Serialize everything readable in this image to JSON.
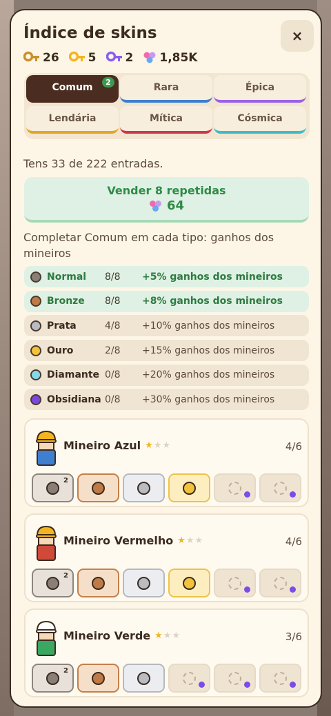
{
  "title": "Índice de skins",
  "close_label": "×",
  "currencies": [
    {
      "icon": "bronze-key-icon",
      "value": "26",
      "color": "#c8902e"
    },
    {
      "icon": "gold-key-icon",
      "value": "5",
      "color": "#f2b51e"
    },
    {
      "icon": "purple-key-icon",
      "value": "2",
      "color": "#8a5cf0"
    },
    {
      "icon": "gems-icon",
      "value": "1,85K",
      "color": "#d06ae6"
    }
  ],
  "tabs": [
    {
      "label": "Comum",
      "active": true,
      "badge": "2",
      "color": "#4a2c20"
    },
    {
      "label": "Rara",
      "color": "#3f7fd0"
    },
    {
      "label": "Épica",
      "color": "#9a62e6"
    },
    {
      "label": "Lendária",
      "color": "#e2a52a"
    },
    {
      "label": "Mítica",
      "color": "#d0374a"
    },
    {
      "label": "Cósmica",
      "color": "#3bbdc9"
    }
  ],
  "entries_text": "Tens 33 de 222 entradas.",
  "sell": {
    "label": "Vender 8 repetidas",
    "value": "64"
  },
  "completion_text": "Completar Comum em cada tipo: ganhos dos mineiros",
  "tiers": [
    {
      "name": "Normal",
      "count": "8/8",
      "bonus": "+5% ganhos dos mineiros",
      "done": true,
      "color": "#8a7f76"
    },
    {
      "name": "Bronze",
      "count": "8/8",
      "bonus": "+8% ganhos dos mineiros",
      "done": true,
      "color": "#c07a45"
    },
    {
      "name": "Prata",
      "count": "4/8",
      "bonus": "+10% ganhos dos mineiros",
      "done": false,
      "color": "#b9bcc3"
    },
    {
      "name": "Ouro",
      "count": "2/8",
      "bonus": "+15% ganhos dos mineiros",
      "done": false,
      "color": "#f2c23a"
    },
    {
      "name": "Diamante",
      "count": "0/8",
      "bonus": "+20% ganhos dos mineiros",
      "done": false,
      "color": "#86d9e6"
    },
    {
      "name": "Obsidiana",
      "count": "0/8",
      "bonus": "+30% ganhos dos mineiros",
      "done": false,
      "color": "#7a48e0"
    }
  ],
  "miners": [
    {
      "name": "Mineiro Azul",
      "count": "4/6",
      "stars": 1,
      "hat": "#f2b51e",
      "shirt": "#3f7fd0",
      "slots": [
        {
          "type": "normal",
          "dup": "2"
        },
        {
          "type": "bronze"
        },
        {
          "type": "prata"
        },
        {
          "type": "ouro"
        },
        {
          "type": "empty"
        },
        {
          "type": "empty"
        }
      ]
    },
    {
      "name": "Mineiro Vermelho",
      "count": "4/6",
      "stars": 1,
      "hat": "#f2b51e",
      "shirt": "#d04a3a",
      "slots": [
        {
          "type": "normal",
          "dup": "2"
        },
        {
          "type": "bronze"
        },
        {
          "type": "prata"
        },
        {
          "type": "ouro"
        },
        {
          "type": "empty"
        },
        {
          "type": "empty"
        }
      ]
    },
    {
      "name": "Mineiro Verde",
      "count": "3/6",
      "stars": 1,
      "hat": "#ffffff",
      "shirt": "#3aa860",
      "slots": [
        {
          "type": "normal",
          "dup": "2"
        },
        {
          "type": "bronze"
        },
        {
          "type": "prata"
        },
        {
          "type": "empty"
        },
        {
          "type": "empty"
        },
        {
          "type": "empty"
        }
      ]
    }
  ],
  "star_filled": "★",
  "star_empty": "★"
}
